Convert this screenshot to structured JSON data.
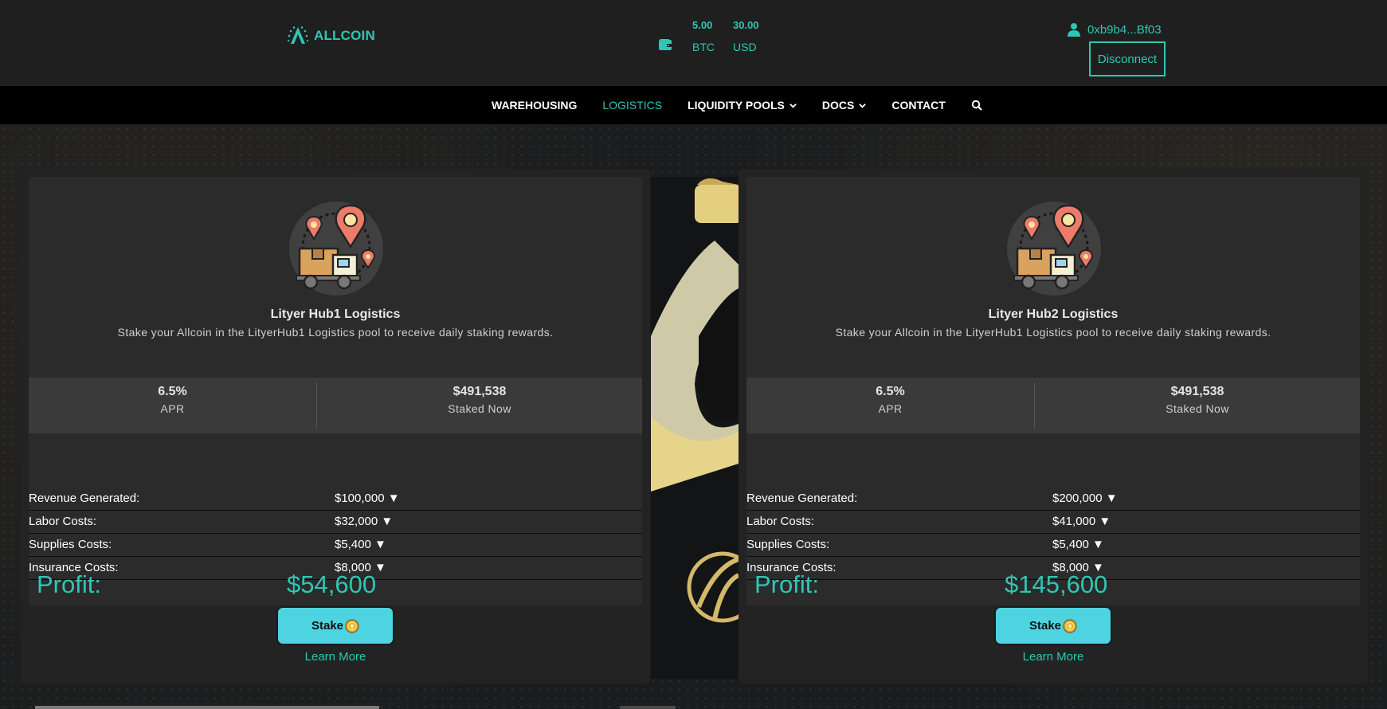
{
  "header": {
    "brand": "ALLCOIN",
    "balances": [
      {
        "amount": "5.00",
        "currency": "BTC"
      },
      {
        "amount": "30.00",
        "currency": "USD"
      }
    ],
    "account": "0xb9b4...Bf03",
    "disconnect_label": "Disconnect"
  },
  "nav": {
    "items": [
      {
        "label": "WAREHOUSING",
        "active": false
      },
      {
        "label": "LOGISTICS",
        "active": true
      },
      {
        "label": "LIQUIDITY POOLS",
        "active": false,
        "dropdown": true
      },
      {
        "label": "DOCS",
        "active": false,
        "dropdown": true
      },
      {
        "label": "CONTACT",
        "active": false
      }
    ],
    "search_icon": "search-icon"
  },
  "pools": [
    {
      "title": "Lityer Hub1 Logistics",
      "description": "Stake your Allcoin in the LityerHub1 Logistics pool to receive daily staking rewards.",
      "apr_value": "6.5%",
      "apr_label": "APR",
      "staked_value": "$491,538",
      "staked_label": "Staked Now",
      "rows": [
        {
          "label": "Revenue Generated:",
          "value": "$100,000 ▼"
        },
        {
          "label": "Labor Costs:",
          "value": "$32,000 ▼"
        },
        {
          "label": "Supplies Costs:",
          "value": "$5,400 ▼"
        },
        {
          "label": "Insurance Costs:",
          "value": "$8,000 ▼"
        }
      ],
      "profit_label": "Profit:",
      "profit_value": "$54,600",
      "stake_label": "Stake",
      "learn_more": "Learn More"
    },
    {
      "title": "Lityer Hub2 Logistics",
      "description": "Stake your Allcoin in the LityerHub1 Logistics pool to receive daily staking rewards.",
      "apr_value": "6.5%",
      "apr_label": "APR",
      "staked_value": "$491,538",
      "staked_label": "Staked Now",
      "rows": [
        {
          "label": "Revenue Generated:",
          "value": "$200,000 ▼"
        },
        {
          "label": "Labor Costs:",
          "value": "$41,000 ▼"
        },
        {
          "label": "Supplies Costs:",
          "value": "$5,400 ▼"
        },
        {
          "label": "Insurance Costs:",
          "value": "$8,000 ▼"
        }
      ],
      "profit_label": "Profit:",
      "profit_value": "$145,600",
      "stake_label": "Stake",
      "learn_more": "Learn More"
    }
  ],
  "colors": {
    "accent": "#2ec7b5",
    "stake_button": "#4dd4e0",
    "header_bg": "#1f1f1f",
    "nav_bg": "#000000",
    "card_bg": "#2b2b2b"
  }
}
